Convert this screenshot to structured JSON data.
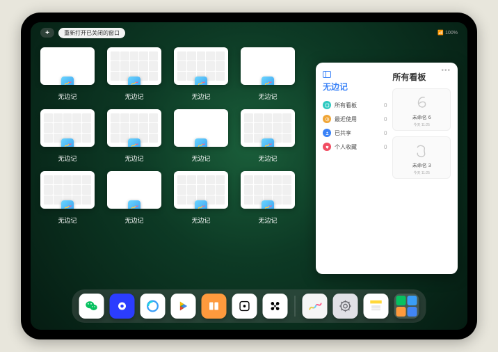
{
  "status": {
    "reopen_label": "重新打开已关闭的窗口",
    "battery": "100%",
    "add_glyph": "+"
  },
  "app": {
    "name": "无边记"
  },
  "thumbs": [
    {
      "label": "无边记",
      "type": "blank"
    },
    {
      "label": "无边记",
      "type": "cal"
    },
    {
      "label": "无边记",
      "type": "cal"
    },
    {
      "label": "无边记",
      "type": "blank"
    },
    {
      "label": "无边记",
      "type": "cal"
    },
    {
      "label": "无边记",
      "type": "cal"
    },
    {
      "label": "无边记",
      "type": "blank"
    },
    {
      "label": "无边记",
      "type": "cal"
    },
    {
      "label": "无边记",
      "type": "cal"
    },
    {
      "label": "无边记",
      "type": "blank"
    },
    {
      "label": "无边记",
      "type": "cal"
    },
    {
      "label": "无边记",
      "type": "cal"
    }
  ],
  "panel": {
    "left_title": "无边记",
    "right_title": "所有看板",
    "rows": [
      {
        "label": "所有看板",
        "count": "0",
        "color": "#2ec9c0"
      },
      {
        "label": "最近使用",
        "count": "0",
        "color": "#f0a637"
      },
      {
        "label": "已共享",
        "count": "0",
        "color": "#3a82f7"
      },
      {
        "label": "个人收藏",
        "count": "0",
        "color": "#f14d62"
      }
    ],
    "boards": [
      {
        "name": "未命名 6",
        "time": "今天 11:25",
        "scribble": "6"
      },
      {
        "name": "未命名 3",
        "time": "今天 11:25",
        "scribble": "3"
      }
    ]
  },
  "dock": [
    {
      "name": "wechat",
      "bg": "#fff"
    },
    {
      "name": "quark",
      "bg": "#2b3dff"
    },
    {
      "name": "qqbrowser",
      "bg": "#fff"
    },
    {
      "name": "play",
      "bg": "#fff"
    },
    {
      "name": "books",
      "bg": "#ff9a3d"
    },
    {
      "name": "dice",
      "bg": "#fff"
    },
    {
      "name": "dots",
      "bg": "#fff"
    },
    {
      "name": "freeform",
      "bg": "#f5f5f5"
    },
    {
      "name": "settings",
      "bg": "#e1e1e6"
    },
    {
      "name": "notes",
      "bg": "#fff"
    },
    {
      "name": "recents",
      "bg": "rgba(255,255,255,0.15)"
    }
  ],
  "colors": {
    "accent_blue": "#3a82f7"
  }
}
